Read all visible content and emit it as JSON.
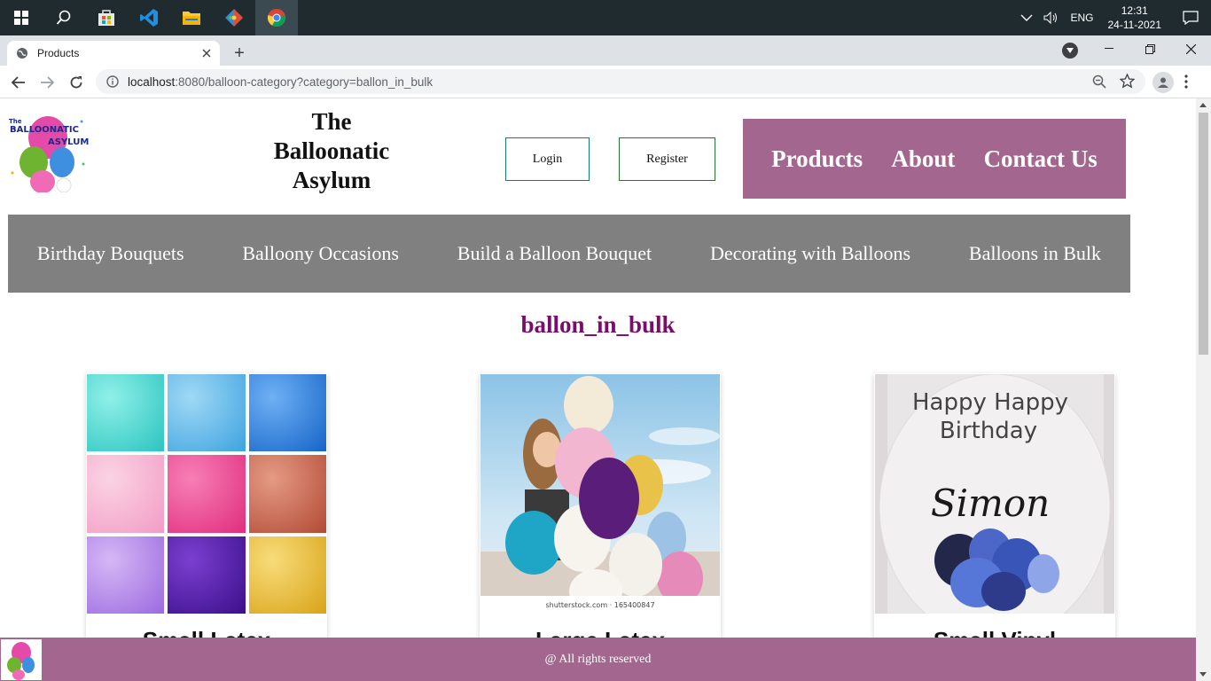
{
  "taskbar": {
    "language": "ENG",
    "time": "12:31",
    "date": "24-11-2021"
  },
  "browser": {
    "tab_title": "Products",
    "url_host": "localhost",
    "url_rest": ":8080/balloon-category?category=ballon_in_bulk"
  },
  "site": {
    "title_line1": "The",
    "title_line2": "Balloonatic",
    "title_line3": "Asylum",
    "login_label": "Login",
    "register_label": "Register",
    "main_nav": [
      "Products",
      "About",
      "Contact Us"
    ],
    "categories": [
      "Birthday Bouquets",
      "Balloony Occasions",
      "Build a Balloon Bouquet",
      "Decorating with Balloons",
      "Balloons in Bulk"
    ],
    "category_heading": "ballon_in_bulk",
    "products": [
      {
        "title": "Small Latex"
      },
      {
        "title": "Large Latex"
      },
      {
        "title": "Small Vinyl"
      }
    ],
    "watermark": "shutterstock.com · 165400847",
    "bubble_text_1": "Happy Happy",
    "bubble_text_2": "Birthday",
    "bubble_name": "Simon",
    "footer_text": "@ All rights reserved"
  },
  "colors": {
    "brand": "#a3678f",
    "category_bar": "#808080",
    "heading": "#7a0d6a"
  }
}
